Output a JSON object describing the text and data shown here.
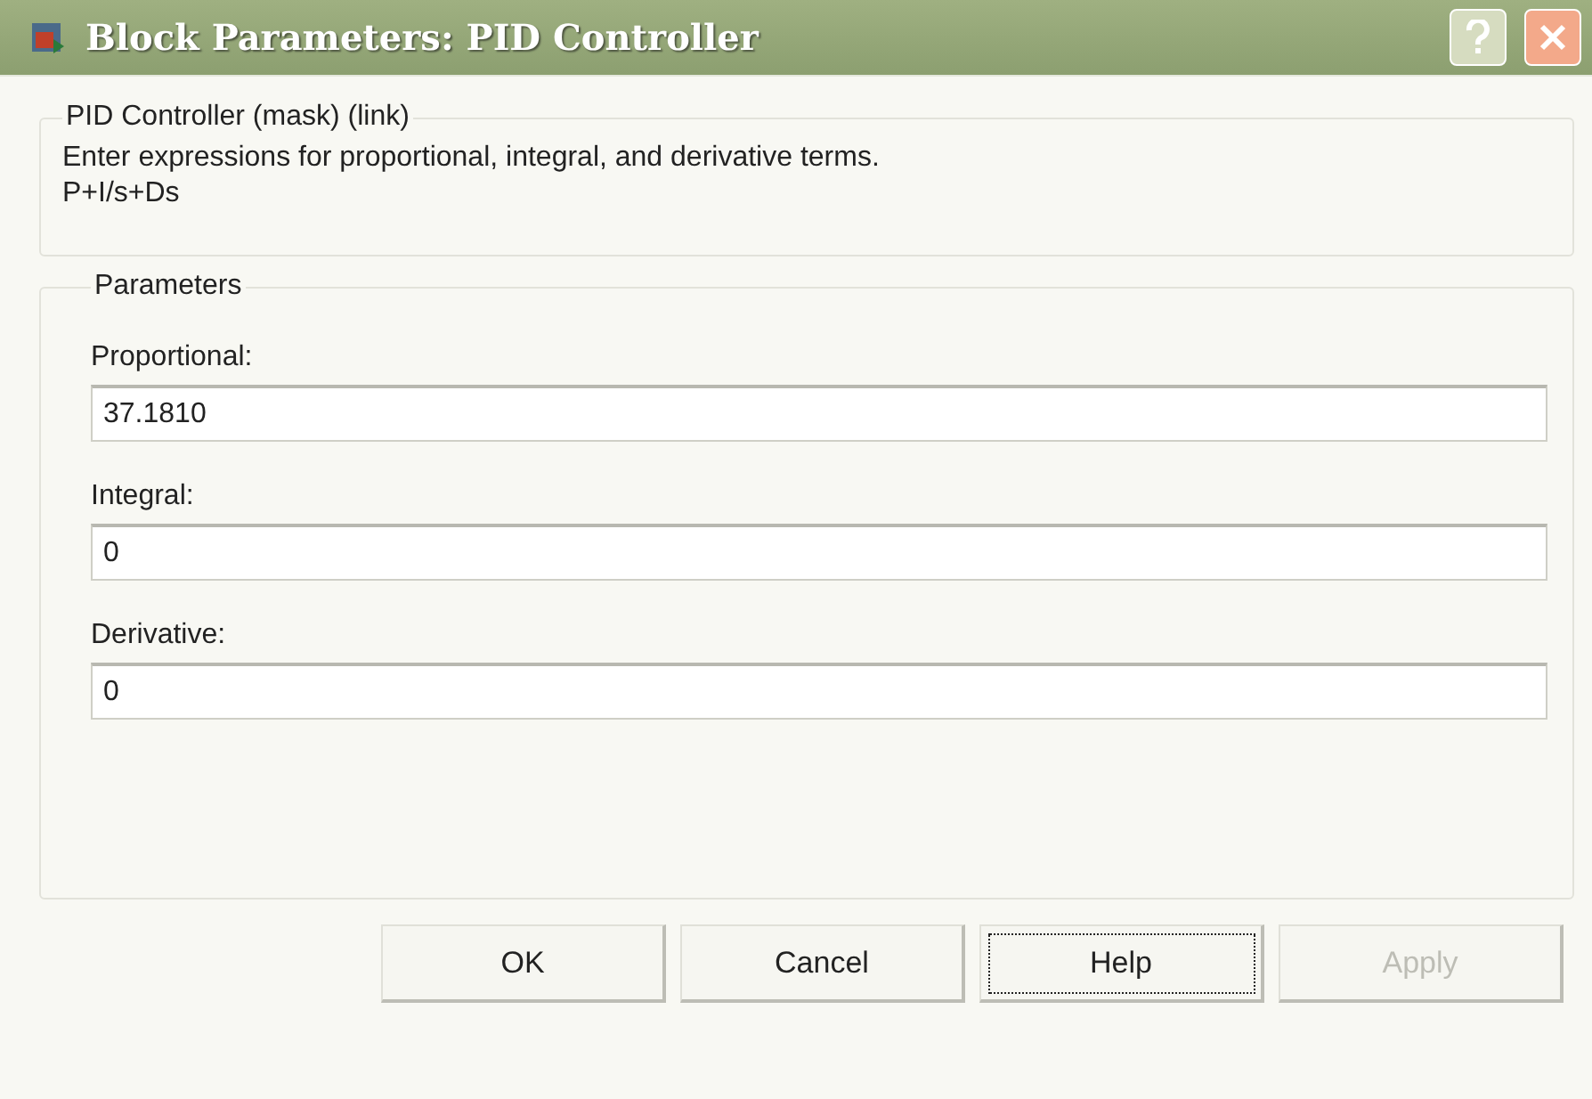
{
  "window": {
    "title": "Block Parameters: PID Controller"
  },
  "description_group": {
    "title": "PID Controller (mask) (link)",
    "lines": [
      "Enter expressions for proportional, integral, and derivative terms.",
      "P+I/s+Ds"
    ]
  },
  "parameters_group": {
    "title": "Parameters",
    "fields": [
      {
        "label": "Proportional:",
        "value": "37.1810"
      },
      {
        "label": "Integral:",
        "value": "0"
      },
      {
        "label": "Derivative:",
        "value": "0"
      }
    ]
  },
  "buttons": [
    {
      "label": "OK",
      "focused": false,
      "disabled": false
    },
    {
      "label": "Cancel",
      "focused": false,
      "disabled": false
    },
    {
      "label": "Help",
      "focused": true,
      "disabled": false
    },
    {
      "label": "Apply",
      "focused": false,
      "disabled": true
    }
  ]
}
